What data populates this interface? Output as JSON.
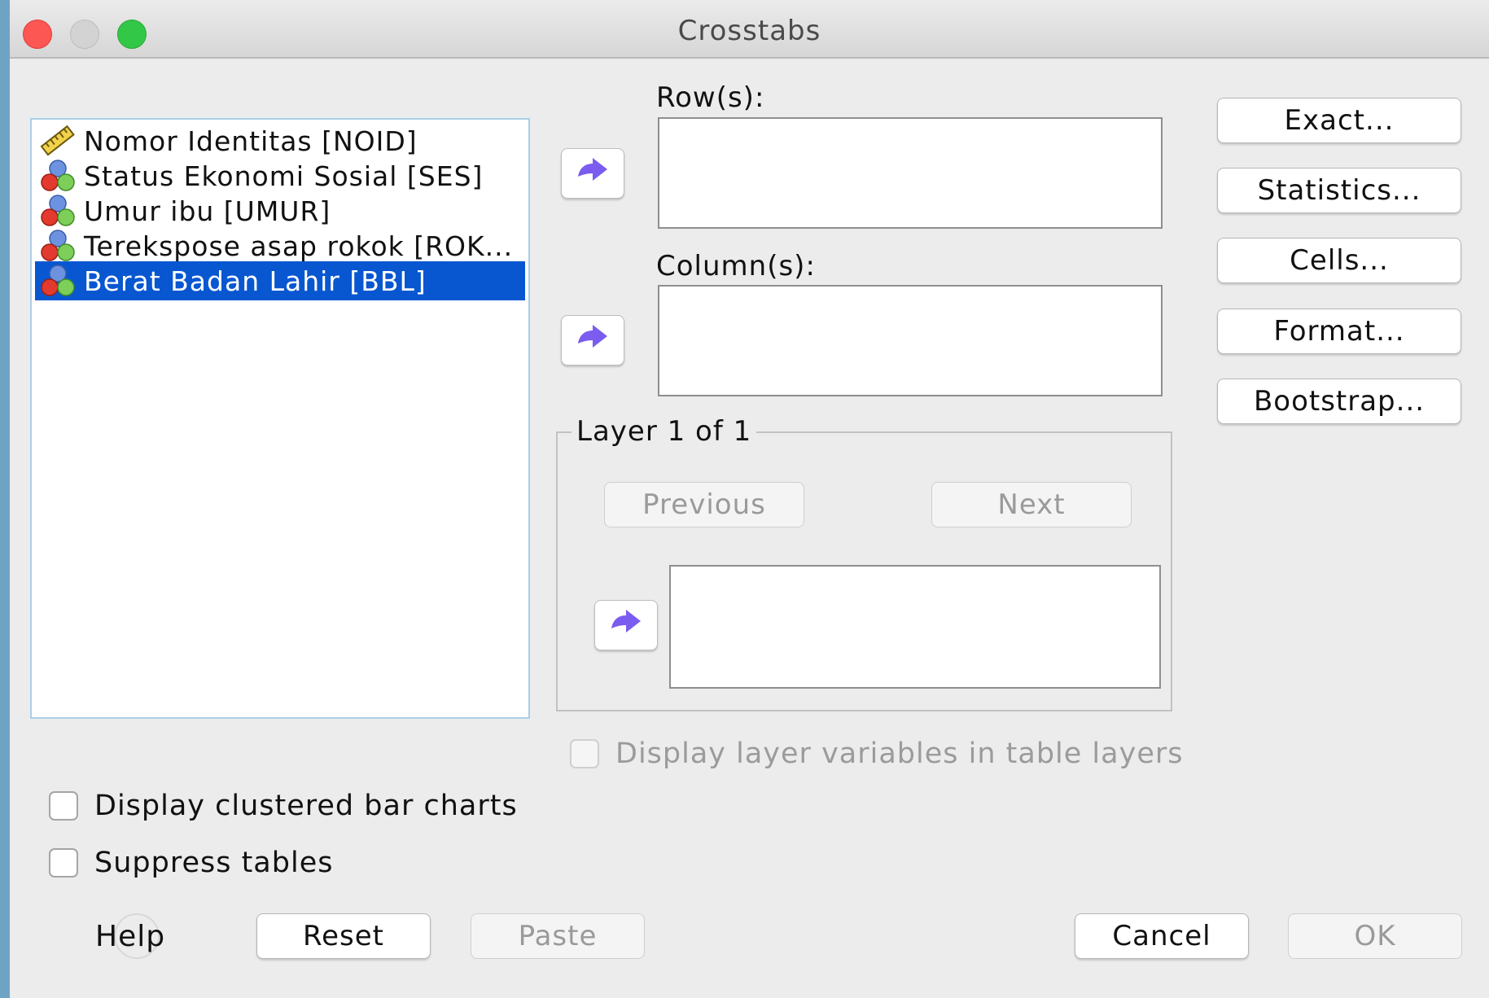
{
  "window": {
    "title": "Crosstabs"
  },
  "variables": [
    {
      "label": "Nomor Identitas [NOID]",
      "icon": "scale-ruler-icon",
      "selected": false
    },
    {
      "label": "Status Ekonomi Sosial [SES]",
      "icon": "nominal-variable-icon",
      "selected": false
    },
    {
      "label": "Umur ibu [UMUR]",
      "icon": "nominal-variable-icon",
      "selected": false
    },
    {
      "label": "Terekspose asap rokok [ROK...",
      "icon": "nominal-variable-icon",
      "selected": false
    },
    {
      "label": "Berat Badan Lahir [BBL]",
      "icon": "nominal-variable-icon",
      "selected": true
    }
  ],
  "rows": {
    "label": "Row(s):"
  },
  "columns": {
    "label": "Column(s):"
  },
  "layer": {
    "title": "Layer 1 of 1",
    "previous": "Previous",
    "next": "Next"
  },
  "side_buttons": {
    "exact": "Exact...",
    "statistics": "Statistics...",
    "cells": "Cells...",
    "format": "Format...",
    "bootstrap": "Bootstrap..."
  },
  "options": {
    "display_layer_vars": "Display layer variables in table layers",
    "clustered_bar": "Display clustered bar charts",
    "suppress_tables": "Suppress tables"
  },
  "footer": {
    "help": "Help",
    "reset": "Reset",
    "paste": "Paste",
    "cancel": "Cancel",
    "ok": "OK"
  },
  "colors": {
    "selection": "#0857d1",
    "arrow": "#7b5cf0",
    "list_border": "#a9cfe8"
  }
}
